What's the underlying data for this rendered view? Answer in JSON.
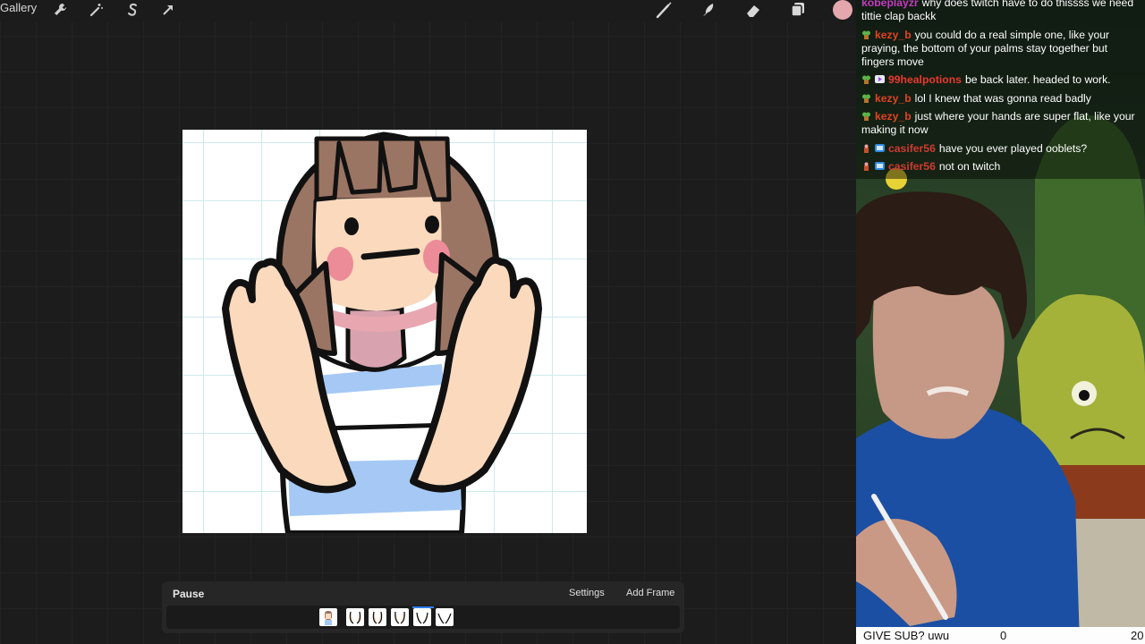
{
  "toolbar": {
    "gallery_label": "Gallery",
    "left_icons": [
      "wrench-icon",
      "magic-wand-icon",
      "selection-s-icon",
      "transform-arrow-icon"
    ],
    "right_icons": [
      "brush-icon",
      "smudge-icon",
      "eraser-icon",
      "layers-icon"
    ],
    "current_color": "#e3a7ad"
  },
  "animation_panel": {
    "pause_label": "Pause",
    "settings_label": "Settings",
    "add_frame_label": "Add Frame",
    "frames_count": 6,
    "selected_frame": 5
  },
  "chat": {
    "messages": [
      {
        "user": "kobeplayzr",
        "text": "why does twitch have to do thissss we need tittie clap backk"
      },
      {
        "user": "kezy_b",
        "text": "you could do a real simple one, like your praying, the bottom of your palms stay together but fingers move"
      },
      {
        "user": "99healpotions",
        "text": "be back later. headed to work."
      },
      {
        "user": "kezy_b",
        "text": "lol I knew that was gonna read badly"
      },
      {
        "user": "kezy_b",
        "text": "just where your hands are super flat, like your making it now"
      },
      {
        "user": "casifer56",
        "text": "have you ever played ooblets?"
      },
      {
        "user": "casifer56",
        "text": "not on twitch"
      }
    ]
  },
  "goal_bar": {
    "label": "GIVE SUB? uwu",
    "current": "0",
    "target": "20"
  }
}
